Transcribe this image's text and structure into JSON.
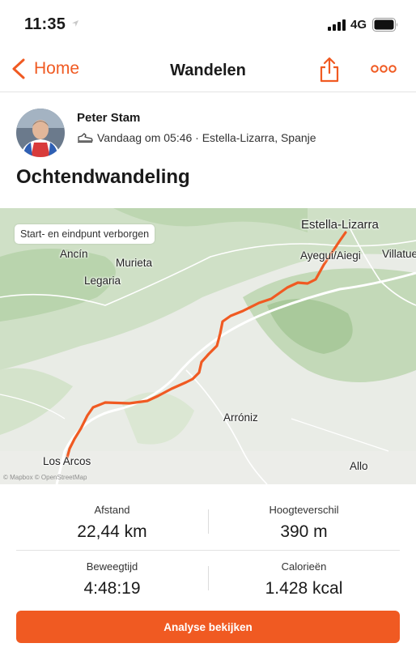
{
  "status_bar": {
    "time": "11:35",
    "network": "4G"
  },
  "nav": {
    "back_label": "Home",
    "title": "Wandelen"
  },
  "athlete": {
    "name": "Peter Stam",
    "meta": "Vandaag om 05:46 · Estella-Lizarra, Spanje"
  },
  "activity": {
    "title": "Ochtendwandeling"
  },
  "map": {
    "privacy_chip": "Start- en eindpunt verborgen",
    "attribution": "© Mapbox © OpenStreetMap",
    "route_color": "#f05a22",
    "places": {
      "estella": "Estella-Lizarra",
      "ayegui": "Ayegui/Aiegi",
      "villatuerta": "Villatue",
      "ancin": "Ancín",
      "murieta": "Murieta",
      "legaria": "Legaria",
      "arroniz": "Arróniz",
      "losarcos": "Los Arcos",
      "allo": "Allo"
    }
  },
  "stats": {
    "distance": {
      "label": "Afstand",
      "value": "22,44 km"
    },
    "elevation": {
      "label": "Hoogteverschil",
      "value": "390 m"
    },
    "moving_time": {
      "label": "Beweegtijd",
      "value": "4:48:19"
    },
    "calories": {
      "label": "Calorieën",
      "value": "1.428 kcal"
    }
  },
  "cta": {
    "label": "Analyse bekijken"
  },
  "colors": {
    "accent": "#f05a22"
  }
}
